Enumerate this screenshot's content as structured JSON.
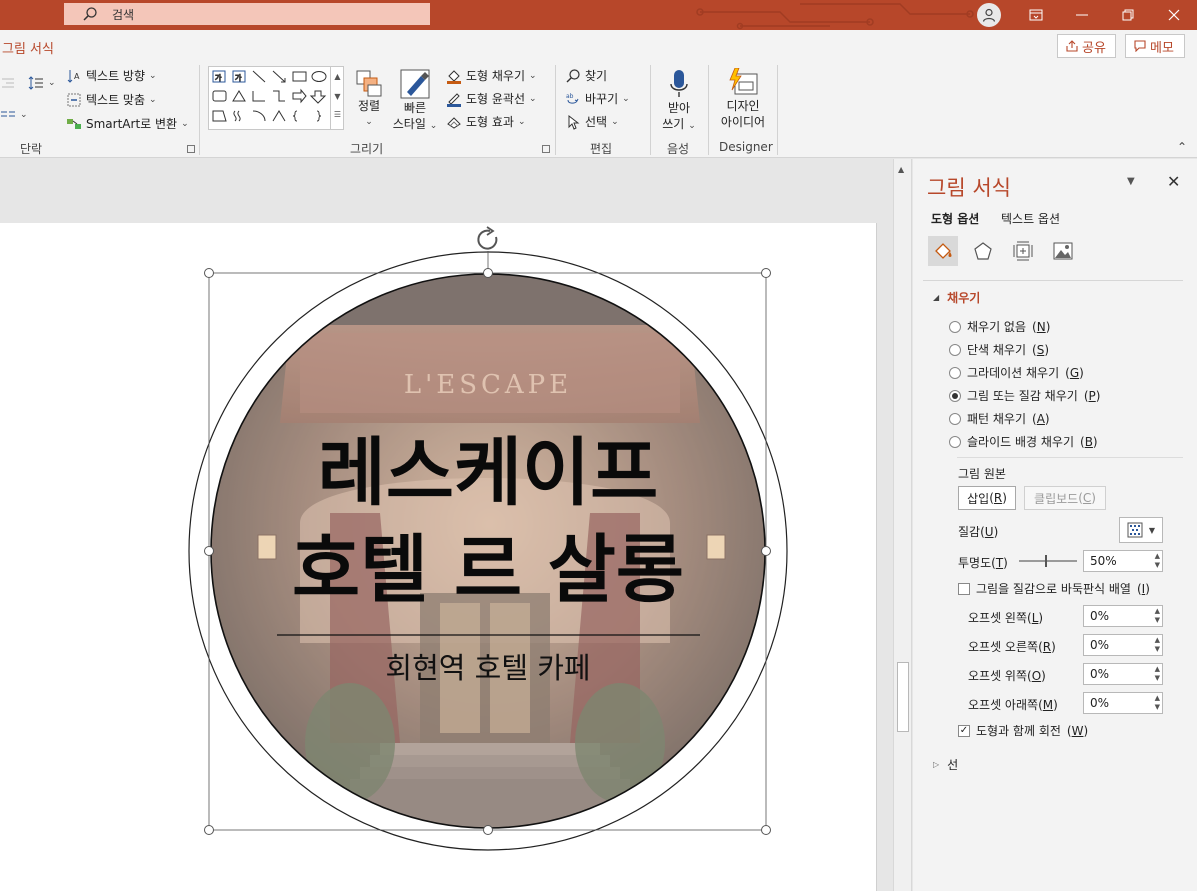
{
  "titlebar": {
    "search_placeholder": "검색",
    "colors": {
      "accent": "#b7472a",
      "search_bg": "#f4c6b9"
    }
  },
  "ribbon": {
    "context_tab": "그림 서식",
    "share_label": "공유",
    "memo_label": "메모",
    "paragraph": {
      "text_direction": "텍스트 방향",
      "align_text": "텍스트 맞춤",
      "smartart": "SmartArt로 변환",
      "group_label": "단락"
    },
    "drawing": {
      "arrange": "정렬",
      "quick_styles_line1": "빠른",
      "quick_styles_line2": "스타일",
      "shape_fill": "도형 채우기",
      "shape_outline": "도형 윤곽선",
      "shape_effects": "도형 효과",
      "group_label": "그리기"
    },
    "editing": {
      "find": "찾기",
      "replace": "바꾸기",
      "select": "선택",
      "group_label": "편집"
    },
    "voice": {
      "dictate_line1": "받아",
      "dictate_line2": "쓰기",
      "group_label": "음성"
    },
    "designer": {
      "ideas_line1": "디자인",
      "ideas_line2": "아이디어",
      "group_label": "Designer"
    }
  },
  "slide": {
    "title_line1": "레스케이프",
    "title_line2": "호텔 르 살롱",
    "subtitle": "회현역 호텔 카페",
    "sign_text": "L'ESCAPE"
  },
  "pane": {
    "title": "그림 서식",
    "tabs": [
      "도형 옵션",
      "텍스트 옵션"
    ],
    "fill_section": "채우기",
    "fill_options": [
      {
        "label": "채우기 없음",
        "key": "N",
        "checked": false
      },
      {
        "label": "단색 채우기",
        "key": "S",
        "checked": false
      },
      {
        "label": "그라데이션 채우기",
        "key": "G",
        "checked": false
      },
      {
        "label": "그림 또는 질감 채우기",
        "key": "P",
        "checked": true
      },
      {
        "label": "패턴 채우기",
        "key": "A",
        "checked": false
      },
      {
        "label": "슬라이드 배경 채우기",
        "key": "B",
        "checked": false
      }
    ],
    "picture_source": "그림 원본",
    "insert_label": "삽입",
    "insert_key": "R",
    "clipboard_label": "클립보드",
    "clipboard_key": "C",
    "texture_label": "질감",
    "texture_key": "U",
    "transparency_label": "투명도",
    "transparency_key": "T",
    "transparency_value": "50%",
    "tile_label": "그림을 질감으로 바둑판식 배열",
    "tile_key": "I",
    "tile_checked": false,
    "offsets": [
      {
        "label": "오프셋 왼쪽",
        "key": "L",
        "value": "0%"
      },
      {
        "label": "오프셋 오른쪽",
        "key": "R",
        "value": "0%"
      },
      {
        "label": "오프셋 위쪽",
        "key": "O",
        "value": "0%"
      },
      {
        "label": "오프셋 아래쪽",
        "key": "M",
        "value": "0%"
      }
    ],
    "rotate_label": "도형과 함께 회전",
    "rotate_key": "W",
    "rotate_checked": true,
    "line_section": "선"
  }
}
